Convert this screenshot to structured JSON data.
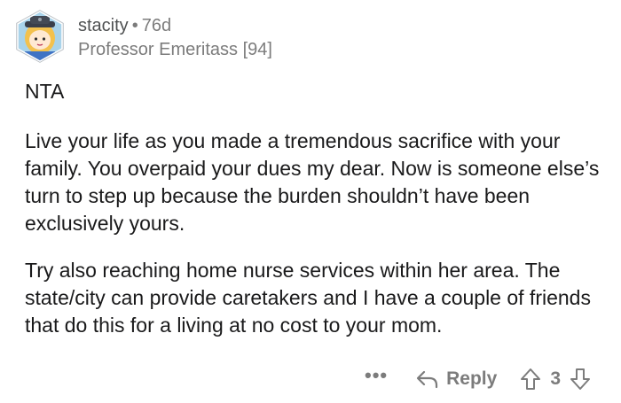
{
  "comment": {
    "username": "stacity",
    "separator": "•",
    "age": "76d",
    "flair": "Professor Emeritass [94]",
    "paragraphs": [
      "NTA",
      "Live your life as you made a tremendous sacrifice with your family. You overpaid your dues my dear. Now is someone else’s turn to step up because the burden shouldn’t have been exclusively yours.",
      "Try also reaching home nurse services within her area. The state/city can provide caretakers and I have a couple of friends that do this for a living at no cost to your mom."
    ]
  },
  "actions": {
    "more_label": "•••",
    "reply_label": "Reply",
    "vote_count": "3"
  }
}
